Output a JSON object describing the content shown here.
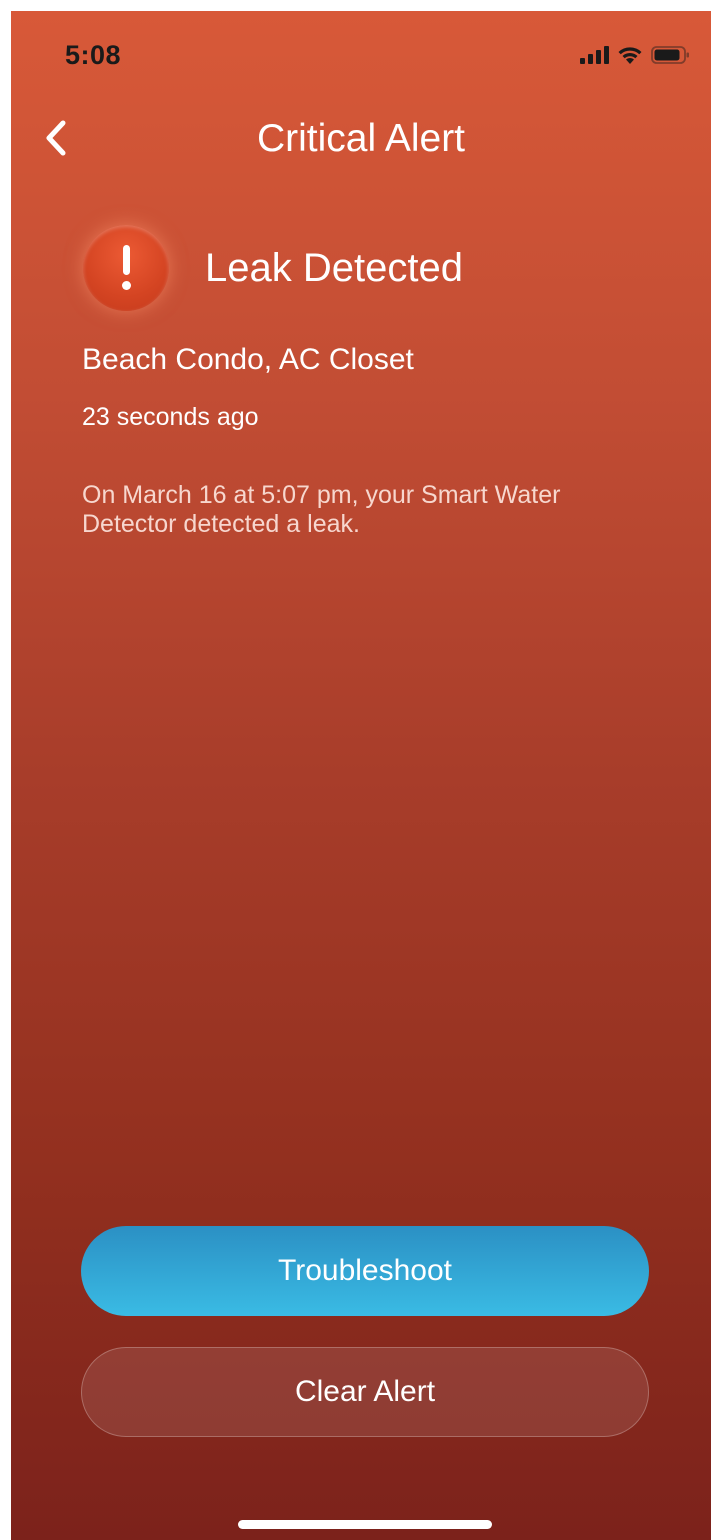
{
  "status_bar": {
    "time": "5:08",
    "icons": [
      "signal-icon",
      "wifi-icon",
      "battery-icon"
    ]
  },
  "nav": {
    "back_icon": "chevron-left-icon",
    "title": "Critical Alert"
  },
  "alert": {
    "icon": "exclamation-icon",
    "title": "Leak Detected",
    "location": "Beach Condo, AC Closet",
    "time_ago": "23 seconds ago",
    "description": "On March 16 at 5:07 pm, your Smart Water Detector detected a leak."
  },
  "actions": {
    "troubleshoot_label": "Troubleshoot",
    "clear_label": "Clear Alert"
  },
  "colors": {
    "background_top": "#d85938",
    "background_bottom": "#7c221b",
    "primary_button": "#3abbe4",
    "alert_icon": "#d44422"
  }
}
